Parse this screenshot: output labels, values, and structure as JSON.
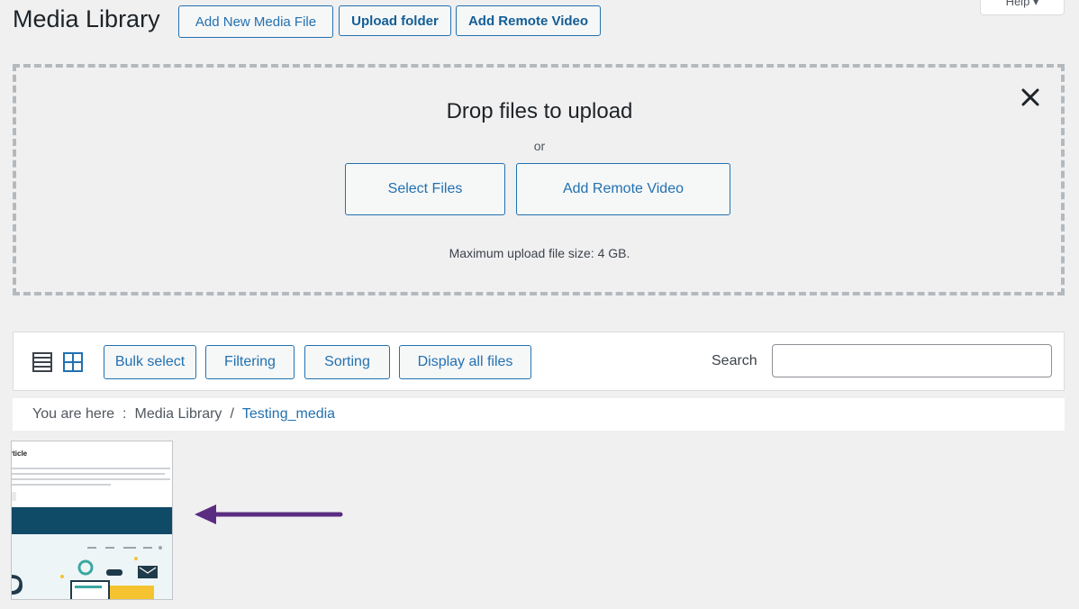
{
  "header": {
    "title": "Media Library",
    "add_new_label": "Add New Media File",
    "upload_folder_label": "Upload folder",
    "add_remote_label": "Add Remote Video",
    "help_label": "Help ▾"
  },
  "uploader": {
    "title": "Drop files to upload",
    "or_text": "or",
    "select_files_label": "Select Files",
    "add_remote_label": "Add Remote Video",
    "max_size_text": "Maximum upload file size: 4 GB.",
    "close_icon": "close-icon"
  },
  "toolbar": {
    "list_view_icon": "list-view-icon",
    "grid_view_icon": "grid-view-icon",
    "bulk_select_label": "Bulk select",
    "filtering_label": "Filtering",
    "sorting_label": "Sorting",
    "display_all_label": "Display all files",
    "search_label": "Search",
    "search_value": ""
  },
  "breadcrumb": {
    "prefix": "You are here",
    "separator_colon": ":",
    "root": "Media Library",
    "separator_slash": "/",
    "current": "Testing_media"
  },
  "thumbnail": {
    "heading_text": "rticle"
  },
  "colors": {
    "accent": "#2271b1",
    "arrow": "#5b2d82",
    "banner": "#0f4a66"
  }
}
